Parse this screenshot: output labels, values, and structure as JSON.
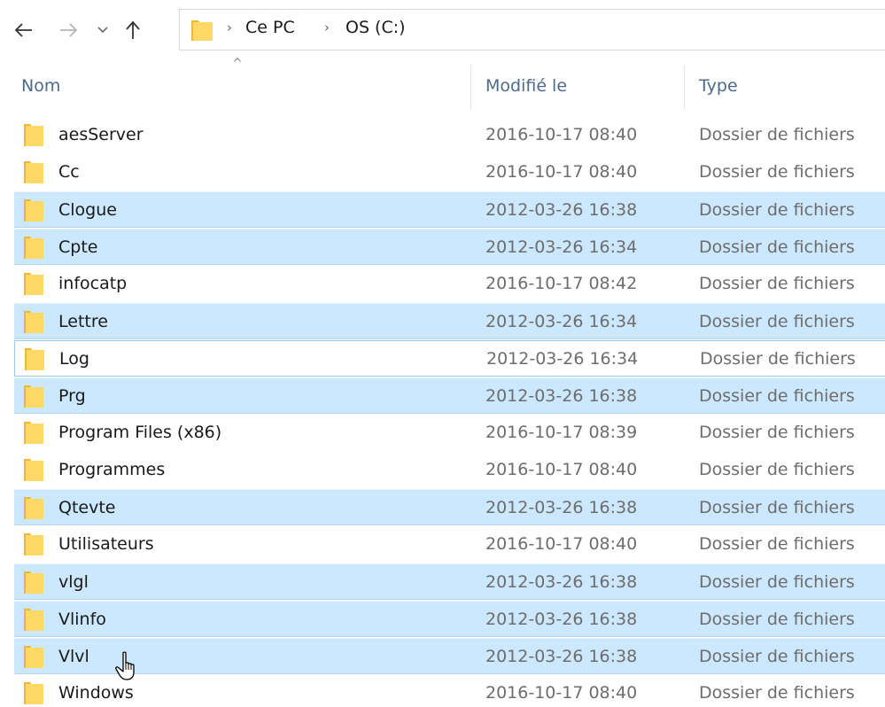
{
  "navigation": {
    "back_icon": "arrow-left-icon",
    "forward_icon": "arrow-right-icon",
    "recent_icon": "chevron-down-icon",
    "up_icon": "arrow-up-icon"
  },
  "address_bar": {
    "folder_icon": "folder-icon",
    "separator": "›",
    "breadcrumbs": [
      "Ce PC",
      "OS (C:)"
    ]
  },
  "columns": {
    "name": "Nom",
    "modified": "Modifié le",
    "type": "Type",
    "sort_indicator": "^"
  },
  "colors": {
    "selection": "#cce8ff",
    "folder_body": "#ffd866",
    "folder_tab": "#e8b93a",
    "header_text": "#4d6b8a"
  },
  "rows": [
    {
      "name": "aesServer",
      "modified": "2016-10-17 08:40",
      "type": "Dossier de fichiers",
      "state": "normal"
    },
    {
      "name": "Cc",
      "modified": "2016-10-17 08:40",
      "type": "Dossier de fichiers",
      "state": "normal"
    },
    {
      "name": "Clogue",
      "modified": "2012-03-26 16:38",
      "type": "Dossier de fichiers",
      "state": "selected"
    },
    {
      "name": "Cpte",
      "modified": "2012-03-26 16:34",
      "type": "Dossier de fichiers",
      "state": "selected"
    },
    {
      "name": "infocatp",
      "modified": "2016-10-17 08:42",
      "type": "Dossier de fichiers",
      "state": "normal"
    },
    {
      "name": "Lettre",
      "modified": "2012-03-26 16:34",
      "type": "Dossier de fichiers",
      "state": "selected"
    },
    {
      "name": "Log",
      "modified": "2012-03-26 16:34",
      "type": "Dossier de fichiers",
      "state": "focused"
    },
    {
      "name": "Prg",
      "modified": "2012-03-26 16:38",
      "type": "Dossier de fichiers",
      "state": "selected"
    },
    {
      "name": "Program Files (x86)",
      "modified": "2016-10-17 08:39",
      "type": "Dossier de fichiers",
      "state": "normal"
    },
    {
      "name": "Programmes",
      "modified": "2016-10-17 08:40",
      "type": "Dossier de fichiers",
      "state": "normal"
    },
    {
      "name": "Qtevte",
      "modified": "2012-03-26 16:38",
      "type": "Dossier de fichiers",
      "state": "selected"
    },
    {
      "name": "Utilisateurs",
      "modified": "2016-10-17 08:40",
      "type": "Dossier de fichiers",
      "state": "normal"
    },
    {
      "name": "vlgl",
      "modified": "2012-03-26 16:38",
      "type": "Dossier de fichiers",
      "state": "selected"
    },
    {
      "name": "Vlinfo",
      "modified": "2012-03-26 16:38",
      "type": "Dossier de fichiers",
      "state": "selected"
    },
    {
      "name": "Vlvl",
      "modified": "2012-03-26 16:38",
      "type": "Dossier de fichiers",
      "state": "selected"
    },
    {
      "name": "Windows",
      "modified": "2016-10-17 08:40",
      "type": "Dossier de fichiers",
      "state": "normal"
    }
  ],
  "cursor_icon": "hand-pointer-icon"
}
